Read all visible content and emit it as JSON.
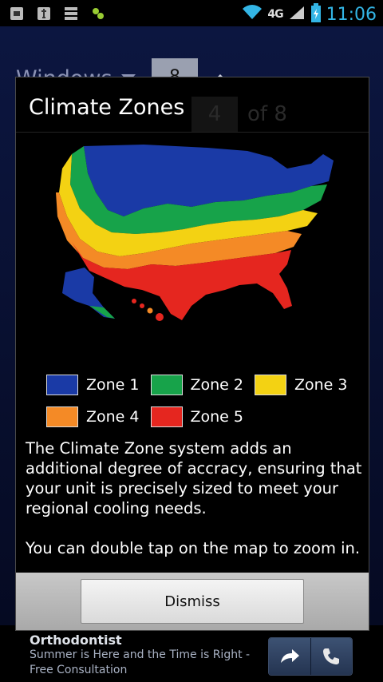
{
  "statusbar": {
    "time": "11:06",
    "network": "4G",
    "icons": [
      "package-icon",
      "usb-icon",
      "list-icon",
      "apps-icon",
      "wifi-icon",
      "signal-icon",
      "battery-icon"
    ]
  },
  "background": {
    "windows_label": "Windows",
    "windows_value": "8",
    "ghost_value": "4",
    "ghost_of": "of 8"
  },
  "dialog": {
    "title": "Climate Zones",
    "legend": [
      {
        "label": "Zone 1",
        "color": "#1a3aa6"
      },
      {
        "label": "Zone 2",
        "color": "#17a34a"
      },
      {
        "label": "Zone 3",
        "color": "#f3d213"
      },
      {
        "label": "Zone 4",
        "color": "#f48a26"
      },
      {
        "label": "Zone 5",
        "color": "#e5261f"
      }
    ],
    "body_p1": "The Climate Zone system adds an additional degree of accracy, ensuring that your unit is precisely sized to meet your regional cooling needs.",
    "body_p2": "You can double tap on the map to zoom in.",
    "dismiss_label": "Dismiss"
  },
  "ad": {
    "title": "Orthodontist",
    "text": "Summer is Here and the Time is Right - Free Consultation"
  }
}
